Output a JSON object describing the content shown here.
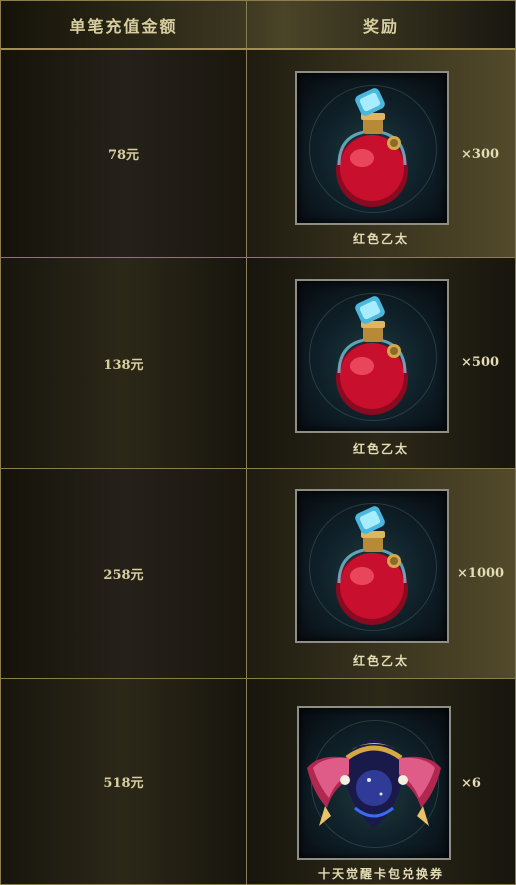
{
  "header": {
    "col_amount": "单笔充值金额",
    "col_reward": "奖励"
  },
  "rows": [
    {
      "amount": "78元",
      "item_name": "红色乙太",
      "quantity": "×300",
      "icon": "red-ether-potion-icon"
    },
    {
      "amount": "138元",
      "item_name": "红色乙太",
      "quantity": "×500",
      "icon": "red-ether-potion-icon"
    },
    {
      "amount": "258元",
      "item_name": "红色乙太",
      "quantity": "×1000",
      "icon": "red-ether-potion-icon"
    },
    {
      "amount": "518元",
      "item_name": "十天觉醒卡包兑换券",
      "quantity": "×6",
      "icon": "awakening-card-pack-emblem-icon"
    }
  ],
  "colors": {
    "border": "#8b7d4c",
    "text": "#d8cfa0",
    "potion": "#c8102e",
    "glass": "#5fc8e6"
  }
}
